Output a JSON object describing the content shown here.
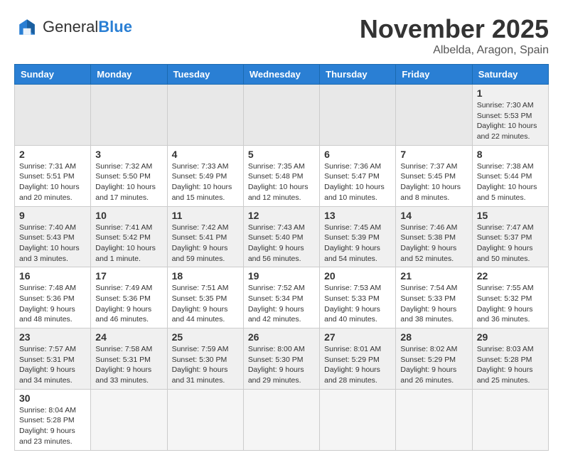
{
  "header": {
    "logo_general": "General",
    "logo_blue": "Blue",
    "month_title": "November 2025",
    "location": "Albelda, Aragon, Spain"
  },
  "weekdays": [
    "Sunday",
    "Monday",
    "Tuesday",
    "Wednesday",
    "Thursday",
    "Friday",
    "Saturday"
  ],
  "weeks": [
    [
      {
        "day": "",
        "info": ""
      },
      {
        "day": "",
        "info": ""
      },
      {
        "day": "",
        "info": ""
      },
      {
        "day": "",
        "info": ""
      },
      {
        "day": "",
        "info": ""
      },
      {
        "day": "",
        "info": ""
      },
      {
        "day": "1",
        "info": "Sunrise: 7:30 AM\nSunset: 5:53 PM\nDaylight: 10 hours\nand 22 minutes."
      }
    ],
    [
      {
        "day": "2",
        "info": "Sunrise: 7:31 AM\nSunset: 5:51 PM\nDaylight: 10 hours\nand 20 minutes."
      },
      {
        "day": "3",
        "info": "Sunrise: 7:32 AM\nSunset: 5:50 PM\nDaylight: 10 hours\nand 17 minutes."
      },
      {
        "day": "4",
        "info": "Sunrise: 7:33 AM\nSunset: 5:49 PM\nDaylight: 10 hours\nand 15 minutes."
      },
      {
        "day": "5",
        "info": "Sunrise: 7:35 AM\nSunset: 5:48 PM\nDaylight: 10 hours\nand 12 minutes."
      },
      {
        "day": "6",
        "info": "Sunrise: 7:36 AM\nSunset: 5:47 PM\nDaylight: 10 hours\nand 10 minutes."
      },
      {
        "day": "7",
        "info": "Sunrise: 7:37 AM\nSunset: 5:45 PM\nDaylight: 10 hours\nand 8 minutes."
      },
      {
        "day": "8",
        "info": "Sunrise: 7:38 AM\nSunset: 5:44 PM\nDaylight: 10 hours\nand 5 minutes."
      }
    ],
    [
      {
        "day": "9",
        "info": "Sunrise: 7:40 AM\nSunset: 5:43 PM\nDaylight: 10 hours\nand 3 minutes."
      },
      {
        "day": "10",
        "info": "Sunrise: 7:41 AM\nSunset: 5:42 PM\nDaylight: 10 hours\nand 1 minute."
      },
      {
        "day": "11",
        "info": "Sunrise: 7:42 AM\nSunset: 5:41 PM\nDaylight: 9 hours\nand 59 minutes."
      },
      {
        "day": "12",
        "info": "Sunrise: 7:43 AM\nSunset: 5:40 PM\nDaylight: 9 hours\nand 56 minutes."
      },
      {
        "day": "13",
        "info": "Sunrise: 7:45 AM\nSunset: 5:39 PM\nDaylight: 9 hours\nand 54 minutes."
      },
      {
        "day": "14",
        "info": "Sunrise: 7:46 AM\nSunset: 5:38 PM\nDaylight: 9 hours\nand 52 minutes."
      },
      {
        "day": "15",
        "info": "Sunrise: 7:47 AM\nSunset: 5:37 PM\nDaylight: 9 hours\nand 50 minutes."
      }
    ],
    [
      {
        "day": "16",
        "info": "Sunrise: 7:48 AM\nSunset: 5:36 PM\nDaylight: 9 hours\nand 48 minutes."
      },
      {
        "day": "17",
        "info": "Sunrise: 7:49 AM\nSunset: 5:36 PM\nDaylight: 9 hours\nand 46 minutes."
      },
      {
        "day": "18",
        "info": "Sunrise: 7:51 AM\nSunset: 5:35 PM\nDaylight: 9 hours\nand 44 minutes."
      },
      {
        "day": "19",
        "info": "Sunrise: 7:52 AM\nSunset: 5:34 PM\nDaylight: 9 hours\nand 42 minutes."
      },
      {
        "day": "20",
        "info": "Sunrise: 7:53 AM\nSunset: 5:33 PM\nDaylight: 9 hours\nand 40 minutes."
      },
      {
        "day": "21",
        "info": "Sunrise: 7:54 AM\nSunset: 5:33 PM\nDaylight: 9 hours\nand 38 minutes."
      },
      {
        "day": "22",
        "info": "Sunrise: 7:55 AM\nSunset: 5:32 PM\nDaylight: 9 hours\nand 36 minutes."
      }
    ],
    [
      {
        "day": "23",
        "info": "Sunrise: 7:57 AM\nSunset: 5:31 PM\nDaylight: 9 hours\nand 34 minutes."
      },
      {
        "day": "24",
        "info": "Sunrise: 7:58 AM\nSunset: 5:31 PM\nDaylight: 9 hours\nand 33 minutes."
      },
      {
        "day": "25",
        "info": "Sunrise: 7:59 AM\nSunset: 5:30 PM\nDaylight: 9 hours\nand 31 minutes."
      },
      {
        "day": "26",
        "info": "Sunrise: 8:00 AM\nSunset: 5:30 PM\nDaylight: 9 hours\nand 29 minutes."
      },
      {
        "day": "27",
        "info": "Sunrise: 8:01 AM\nSunset: 5:29 PM\nDaylight: 9 hours\nand 28 minutes."
      },
      {
        "day": "28",
        "info": "Sunrise: 8:02 AM\nSunset: 5:29 PM\nDaylight: 9 hours\nand 26 minutes."
      },
      {
        "day": "29",
        "info": "Sunrise: 8:03 AM\nSunset: 5:28 PM\nDaylight: 9 hours\nand 25 minutes."
      }
    ],
    [
      {
        "day": "30",
        "info": "Sunrise: 8:04 AM\nSunset: 5:28 PM\nDaylight: 9 hours\nand 23 minutes."
      },
      {
        "day": "",
        "info": ""
      },
      {
        "day": "",
        "info": ""
      },
      {
        "day": "",
        "info": ""
      },
      {
        "day": "",
        "info": ""
      },
      {
        "day": "",
        "info": ""
      },
      {
        "day": "",
        "info": ""
      }
    ]
  ]
}
